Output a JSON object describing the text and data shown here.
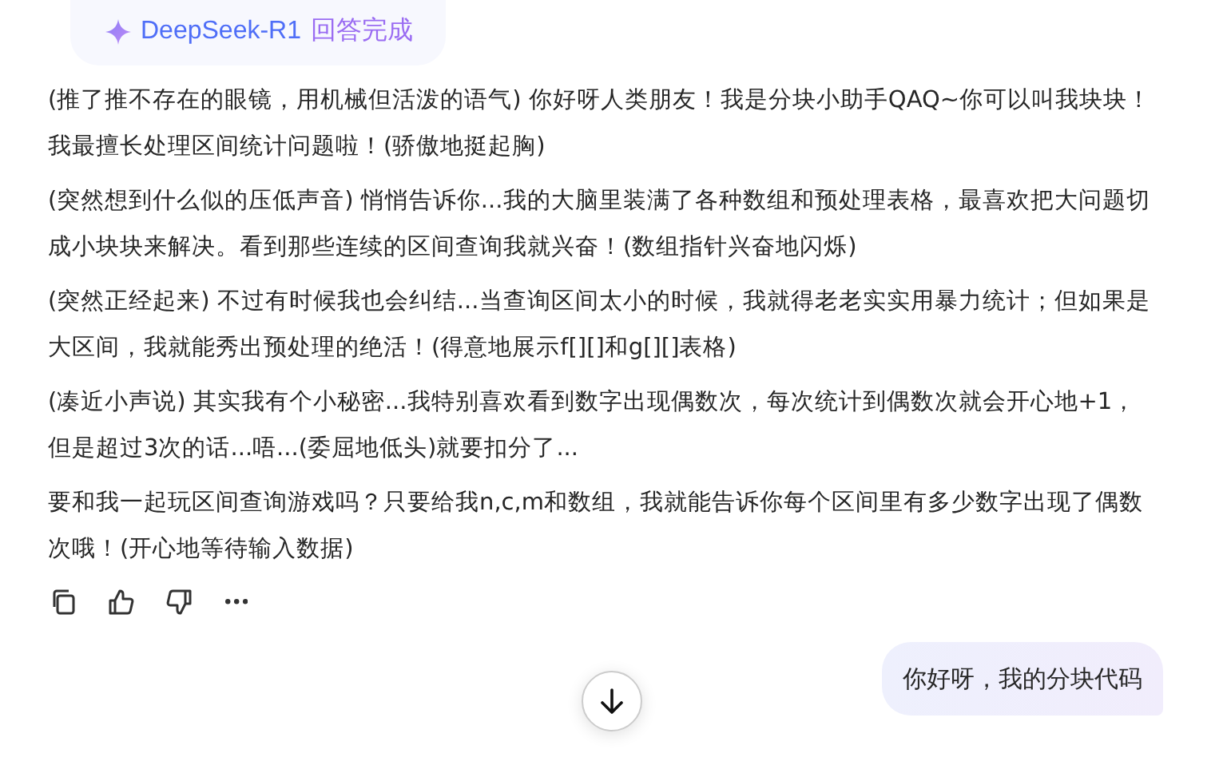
{
  "response_badge": {
    "model": "DeepSeek-R1",
    "status": "回答完成"
  },
  "paragraphs": [
    "(推了推不存在的眼镜，用机械但活泼的语气) 你好呀人类朋友！我是分块小助手QAQ~你可以叫我块块！我最擅长处理区间统计问题啦！(骄傲地挺起胸)",
    "(突然想到什么似的压低声音) 悄悄告诉你...我的大脑里装满了各种数组和预处理表格，最喜欢把大问题切成小块块来解决。看到那些连续的区间查询我就兴奋！(数组指针兴奋地闪烁)",
    "(突然正经起来) 不过有时候我也会纠结...当查询区间太小的时候，我就得老老实实用暴力统计；但如果是大区间，我就能秀出预处理的绝活！(得意地展示f[][]和g[][]表格)",
    "(凑近小声说) 其实我有个小秘密...我特别喜欢看到数字出现偶数次，每次统计到偶数次就会开心地+1，但是超过3次的话...唔...(委屈地低头)就要扣分了...",
    "要和我一起玩区间查询游戏吗？只要给我n,c,m和数组，我就能告诉你每个区间里有多少数字出现了偶数次哦！(开心地等待输入数据)"
  ],
  "actions": [
    {
      "kind": "copy"
    },
    {
      "kind": "like"
    },
    {
      "kind": "dislike"
    },
    {
      "kind": "more"
    }
  ],
  "user_message": "你好呀，我的分块代码"
}
